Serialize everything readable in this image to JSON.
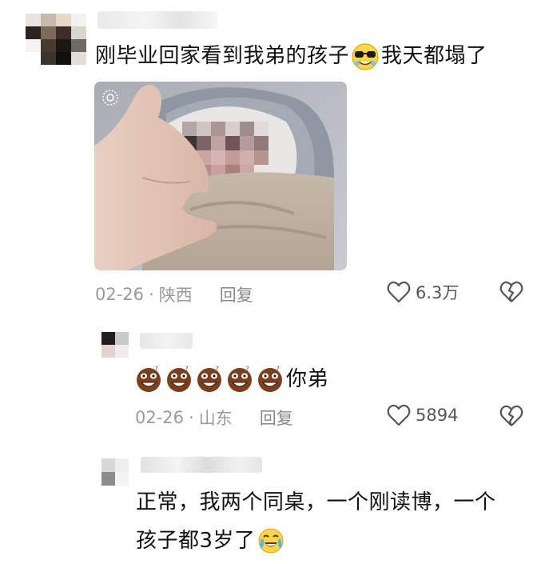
{
  "comments": [
    {
      "text_before": "刚毕业回家看到我弟的孩子",
      "emoji": "cool-sunglasses-emoji",
      "text_after": "我天都塌了",
      "date": "02-26",
      "dot": "·",
      "location": "陕西",
      "reply_label": "回复",
      "likes": "6.3万"
    },
    {
      "emoji": "laughing-brown-emoji",
      "emoji_count": 5,
      "text": "你弟",
      "date": "02-26",
      "dot": "·",
      "location": "山东",
      "reply_label": "回复",
      "likes": "5894"
    },
    {
      "line1": "正常，我两个同桌，一个刚读博，一个",
      "line2": "孩子都3岁了",
      "emoji": "crying-laughing-emoji"
    }
  ],
  "colors": {
    "meta": "#9a9a9a",
    "text": "#111111",
    "icon": "#666666"
  }
}
